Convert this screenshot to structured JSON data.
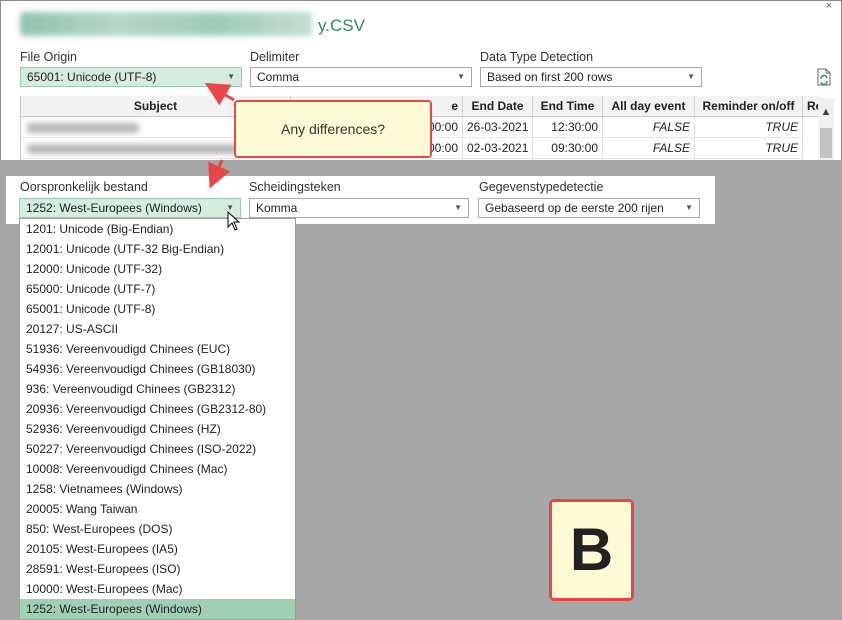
{
  "window": {
    "title_visible_suffix": "y.CSV",
    "close_glyph": "×"
  },
  "import_options": {
    "file_origin_label": "File Origin",
    "file_origin_value": "65001: Unicode (UTF-8)",
    "delimiter_label": "Delimiter",
    "delimiter_value": "Comma",
    "data_type_label": "Data Type Detection",
    "data_type_value": "Based on first 200 rows",
    "refresh_icon": "refresh-icon"
  },
  "table": {
    "headers": [
      "Subject",
      "e",
      "End Date",
      "End Time",
      "All day event",
      "Reminder on/off",
      "Re"
    ],
    "rows": [
      [
        "",
        "00:00",
        "26-03-2021",
        "12:30:00",
        "FALSE",
        "TRUE"
      ],
      [
        "",
        "00:00",
        "02-03-2021",
        "09:30:00",
        "FALSE",
        "TRUE"
      ]
    ]
  },
  "callout": {
    "text": "Any differences?"
  },
  "dutch_options": {
    "origin_label": "Oorspronkelijk bestand",
    "origin_value": "1252: West-Europees (Windows)",
    "separator_label": "Scheidingsteken",
    "separator_value": "Komma",
    "detection_label": "Gegevenstypedetectie",
    "detection_value": "Gebaseerd op de eerste 200 rijen"
  },
  "encoding_list": [
    "1201: Unicode (Big-Endian)",
    "12001: Unicode (UTF-32 Big-Endian)",
    "12000: Unicode (UTF-32)",
    "65000: Unicode (UTF-7)",
    "65001: Unicode (UTF-8)",
    "20127: US-ASCII",
    "51936: Vereenvoudigd Chinees (EUC)",
    "54936: Vereenvoudigd Chinees (GB18030)",
    "936: Vereenvoudigd Chinees (GB2312)",
    "20936: Vereenvoudigd Chinees (GB2312-80)",
    "52936: Vereenvoudigd Chinees (HZ)",
    "50227: Vereenvoudigd Chinees (ISO-2022)",
    "10008: Vereenvoudigd Chinees (Mac)",
    "1258: Vietnamees (Windows)",
    "20005: Wang Taiwan",
    "850: West-Europees (DOS)",
    "20105: West-Europees (IA5)",
    "28591: West-Europees (ISO)",
    "10000: West-Europees (Mac)",
    "1252: West-Europees (Windows)"
  ],
  "encoding_selected_index": 19,
  "badge": {
    "text": "B"
  },
  "colors": {
    "accent_red": "#e8474a",
    "selected_green": "#9fd0b3",
    "title_green": "#2d8a57",
    "callout_fill": "#fdfbd5"
  }
}
